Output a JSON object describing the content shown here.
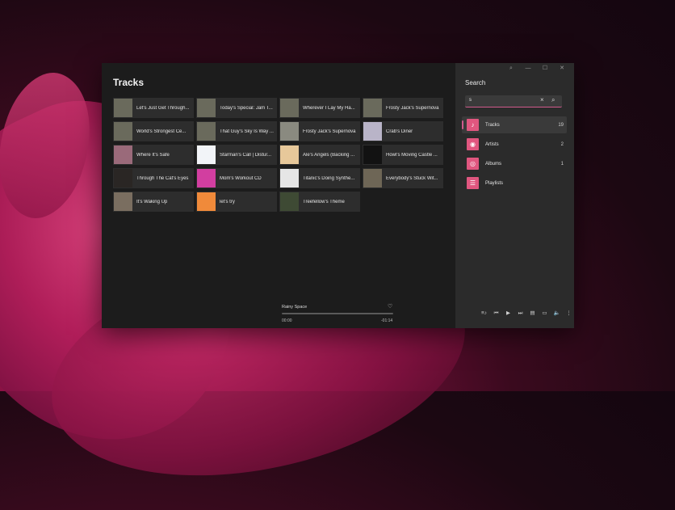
{
  "main": {
    "title": "Tracks",
    "tracks": [
      {
        "label": "Let's Just Get Through...",
        "art": "#6a6a5c"
      },
      {
        "label": "Today's Special: Jam T...",
        "art": "#6a6a5c"
      },
      {
        "label": "Wherever I Lay My Ha...",
        "art": "#6a6a5c"
      },
      {
        "label": "Frosty Jack's Supernova",
        "art": "#6a6a5c"
      },
      {
        "label": "World's Strongest Ce...",
        "art": "#6a6a5c"
      },
      {
        "label": "That Guy's Sky Is Way ...",
        "art": "#6a6a5c"
      },
      {
        "label": "Frosty Jack's Supernova",
        "art": "#8a8a80"
      },
      {
        "label": "Crab's Diner",
        "art": "#b9b4c8"
      },
      {
        "label": "Where It's Safe",
        "art": "#9a6a7a"
      },
      {
        "label": "Starman's Call | Distur...",
        "art": "#f2f4f8"
      },
      {
        "label": "Ale's Angels (Backing ...",
        "art": "#e7c89a"
      },
      {
        "label": "Howl's Moving Castle ...",
        "art": "#121212"
      },
      {
        "label": "Through The Cat's Eyes",
        "art": "#2a2624"
      },
      {
        "label": "Mom's Workout CD",
        "art": "#d23ea0"
      },
      {
        "label": "Titanic's Doing Synthe...",
        "art": "#e6e6e6"
      },
      {
        "label": "Everybody's Stuck Wit...",
        "art": "#6e6656"
      },
      {
        "label": "It's Waking Up",
        "art": "#7a6e60"
      },
      {
        "label": "let's try",
        "art": "#f08a3a"
      },
      {
        "label": "Treefellow's Theme",
        "art": "#3e4a34"
      }
    ]
  },
  "now_playing": {
    "title": "Rainy Space",
    "elapsed": "00:00",
    "remaining": "-01:14",
    "progress_fraction": 0.0
  },
  "search": {
    "title": "Search",
    "query": "s",
    "categories": [
      {
        "label": "Tracks",
        "count": "19",
        "icon": "music-note-icon",
        "glyph": "♪",
        "selected": true
      },
      {
        "label": "Artists",
        "count": "2",
        "icon": "artist-icon",
        "glyph": "◉",
        "selected": false
      },
      {
        "label": "Albums",
        "count": "1",
        "icon": "album-icon",
        "glyph": "◎",
        "selected": false
      },
      {
        "label": "Playlists",
        "count": "",
        "icon": "playlist-icon",
        "glyph": "☰",
        "selected": false
      }
    ]
  },
  "titlebar": {
    "search_glyph": "⌕",
    "minimize_glyph": "—",
    "maximize_glyph": "☐",
    "close_glyph": "✕"
  },
  "controls": [
    {
      "name": "queue-icon",
      "glyph": "≡♪"
    },
    {
      "name": "previous-icon",
      "glyph": "⏮"
    },
    {
      "name": "play-icon",
      "glyph": "▶"
    },
    {
      "name": "next-icon",
      "glyph": "⏭"
    },
    {
      "name": "lyrics-icon",
      "glyph": "▤"
    },
    {
      "name": "miniplayer-icon",
      "glyph": "▭"
    },
    {
      "name": "volume-icon",
      "glyph": "🔈"
    },
    {
      "name": "more-icon",
      "glyph": "⋮"
    }
  ],
  "colors": {
    "accent": "#d05a8c",
    "category_icon": "#e0567f"
  }
}
